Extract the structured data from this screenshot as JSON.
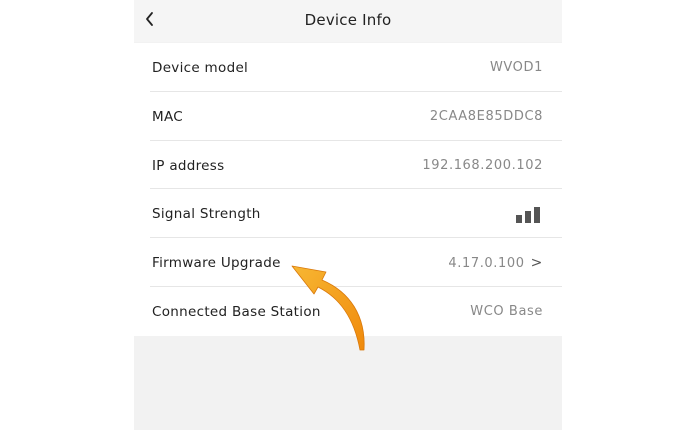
{
  "header": {
    "title": "Device Info",
    "back_icon": "chevron-left-icon"
  },
  "rows": [
    {
      "label": "Device model",
      "value": "WVOD1"
    },
    {
      "label": "MAC",
      "value": "2CAA8E85DDC8"
    },
    {
      "label": "IP address",
      "value": "192.168.200.102"
    },
    {
      "label": "Signal Strength",
      "value_icon": "signal-bars-icon"
    },
    {
      "label": "Firmware Upgrade",
      "value": "4.17.0.100",
      "chevron": ">"
    },
    {
      "label": "Connected Base Station",
      "value": "WCO Base"
    }
  ],
  "colors": {
    "background": "#f2f2f2",
    "list_background": "#ffffff",
    "label_text": "#222222",
    "value_text": "#888888",
    "divider": "#e6e6e6",
    "signal_bars": "#555555",
    "annotation_arrow": "#f5a623"
  },
  "annotation": {
    "icon": "curved-arrow-icon",
    "points_to": "Firmware Upgrade"
  }
}
